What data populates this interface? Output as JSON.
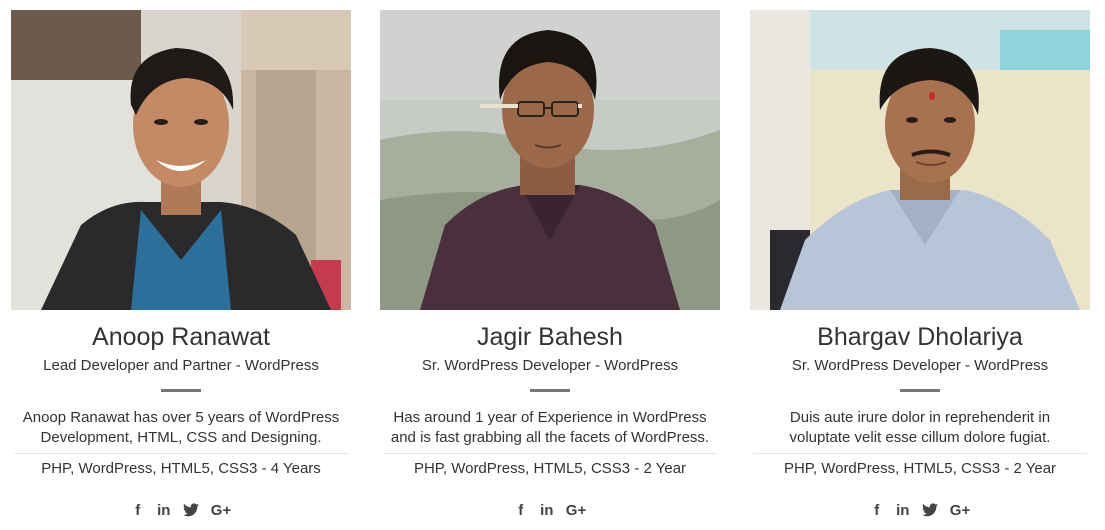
{
  "team": [
    {
      "photo_alt": "Anoop Ranawat",
      "name": "Anoop Ranawat",
      "role": "Lead Developer and Partner - WordPress",
      "bio_lines": [
        "Anoop Ranawat has over 5 years of WordPress",
        "Development, HTML, CSS and Designing."
      ],
      "skills": "PHP, WordPress, HTML5, CSS3 - 4 Years",
      "social": [
        {
          "icon": "facebook-icon",
          "glyph": "f"
        },
        {
          "icon": "linkedin-icon",
          "glyph": "in"
        },
        {
          "icon": "twitter-icon",
          "glyph": ""
        },
        {
          "icon": "google-plus-icon",
          "glyph": "G+"
        }
      ]
    },
    {
      "photo_alt": "Jagir Bahesh",
      "name": "Jagir Bahesh",
      "role": "Sr. WordPress Developer - WordPress",
      "bio_lines": [
        "Has around 1 year of Experience in WordPress",
        "and is fast grabbing all the facets of WordPress."
      ],
      "skills": "PHP, WordPress, HTML5, CSS3 - 2 Year",
      "social": [
        {
          "icon": "facebook-icon",
          "glyph": "f"
        },
        {
          "icon": "linkedin-icon",
          "glyph": "in"
        },
        {
          "icon": "google-plus-icon",
          "glyph": "G+"
        }
      ]
    },
    {
      "photo_alt": "Bhargav Dholariya",
      "name": "Bhargav Dholariya",
      "role": "Sr. WordPress Developer - WordPress",
      "bio_lines": [
        "Duis aute irure dolor in reprehenderit in",
        "voluptate velit esse cillum dolore fugiat."
      ],
      "skills": "PHP, WordPress, HTML5, CSS3 - 2 Year",
      "social": [
        {
          "icon": "facebook-icon",
          "glyph": "f"
        },
        {
          "icon": "linkedin-icon",
          "glyph": "in"
        },
        {
          "icon": "twitter-icon",
          "glyph": ""
        },
        {
          "icon": "google-plus-icon",
          "glyph": "G+"
        }
      ]
    }
  ],
  "colors": {
    "text": "#333333",
    "divider": "#777777",
    "rule": "#e6e6e6",
    "icon": "#444444"
  }
}
